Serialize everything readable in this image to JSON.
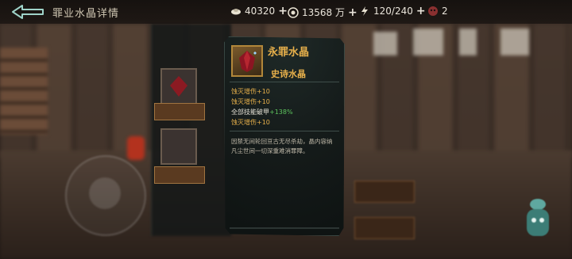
{
  "header": {
    "title": "罪业水晶详情",
    "back_label": "",
    "resources": [
      {
        "icon": "ingot-icon",
        "value": "40320"
      },
      {
        "icon": "coin-icon",
        "value": "13568 万"
      },
      {
        "icon": "lightning-icon",
        "value": "120/240"
      },
      {
        "icon": "skull-token-icon",
        "value": "2"
      }
    ]
  },
  "item": {
    "name": "永罪水晶",
    "quality": "史诗水晶",
    "stats": [
      {
        "name": "蚀灭增伤",
        "value": "+10",
        "style": "gold"
      },
      {
        "name": "蚀灭增伤",
        "value": "+10",
        "style": "gold"
      },
      {
        "name": "全部技能破甲",
        "value": "+138%",
        "style": "green"
      },
      {
        "name": "蚀灭增伤",
        "value": "+10",
        "style": "gold"
      }
    ],
    "description": "因禁无间轮回亘古无尽杀劫，晶内容纳凡尘世间一切深重难消罪障。"
  },
  "colors": {
    "gold": "#e7b04b",
    "green": "#5ec45e",
    "text": "#bfb8a8"
  }
}
